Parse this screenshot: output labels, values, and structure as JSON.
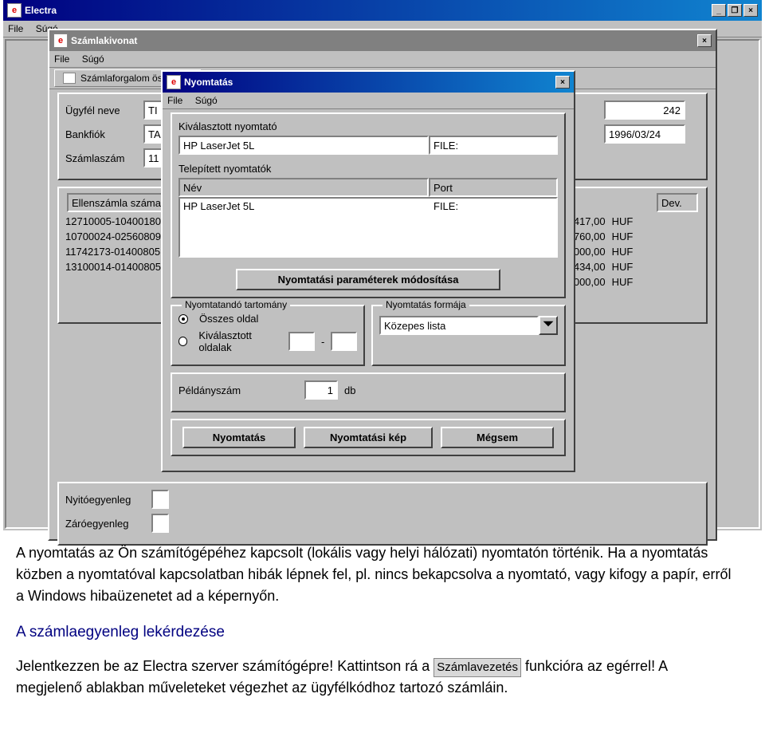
{
  "electra": {
    "title": "Electra",
    "menu": {
      "file": "File",
      "help": "Súgó"
    }
  },
  "statement": {
    "title": "Számlakivonat",
    "menu": {
      "file": "File",
      "help": "Súgó"
    },
    "tab": "Számlaforgalom összesítő",
    "labels": {
      "ugyfel": "Ügyfél neve",
      "bank": "Bankfiók",
      "szamla": "Számlaszám",
      "nyito": "Nyitóegyenleg",
      "zaro": "Záróegyenleg"
    },
    "ugyfel_val": "TI",
    "bank_val": "TA",
    "szamla_val": "11",
    "right_top": "242",
    "right_date": "1996/03/24",
    "headers": {
      "ellenszamla": "Ellenszámla száma",
      "dev": "Dev."
    },
    "rows": [
      {
        "acc": "12710005-10400180",
        "amt": "567 417,00",
        "cur": "HUF"
      },
      {
        "acc": "10700024-02560809",
        "amt": "123 760,00",
        "cur": "HUF"
      },
      {
        "acc": "11742173-01400805",
        "amt": "684 000,00",
        "cur": "HUF"
      },
      {
        "acc": "13100014-01400805",
        "amt": "23 434,00",
        "cur": "HUF"
      },
      {
        "acc": "",
        "amt": "-4 000,00",
        "cur": "HUF"
      }
    ]
  },
  "print": {
    "title": "Nyomtatás",
    "menu": {
      "file": "File",
      "help": "Súgó"
    },
    "labels": {
      "selected": "Kiválasztott nyomtató",
      "installed": "Telepített nyomtatók",
      "name_col": "Név",
      "port_col": "Port",
      "modify_btn": "Nyomtatási paraméterek módosítása",
      "range": "Nyomtatandó tartomány",
      "all": "Összes oldal",
      "sel_pages": "Kiválasztott oldalak",
      "form": "Nyomtatás formája",
      "copies": "Példányszám",
      "db": "db",
      "print_btn": "Nyomtatás",
      "preview_btn": "Nyomtatási kép",
      "cancel_btn": "Mégsem"
    },
    "selected_printer": "HP LaserJet 5L",
    "selected_port": "FILE:",
    "installed_printer": "HP LaserJet 5L",
    "installed_port": "FILE:",
    "form_val": "Közepes lista",
    "copies_val": "1",
    "range_dash": "-"
  },
  "article": {
    "p1": "A nyomtatás az Ön számítógépéhez kapcsolt (lokális vagy helyi hálózati) nyomtatón történik. Ha a nyomtatás közben a nyomtatóval kapcsolatban hibák lépnek fel, pl. nincs bekapcsolva a nyomtató, vagy kifogy a papír, erről a Windows hibaüzenetet ad a képernyőn.",
    "h": "A számlaegyenleg lekérdezése",
    "p2a": "Jelentkezzen be az Electra szerver számítógépre! Kattintson rá a ",
    "link": "Számlavezetés",
    "p2b": " funkcióra az egérrel! A megjelenő ablakban műveleteket végezhet az ügyfélkódhoz tartozó számláin."
  }
}
